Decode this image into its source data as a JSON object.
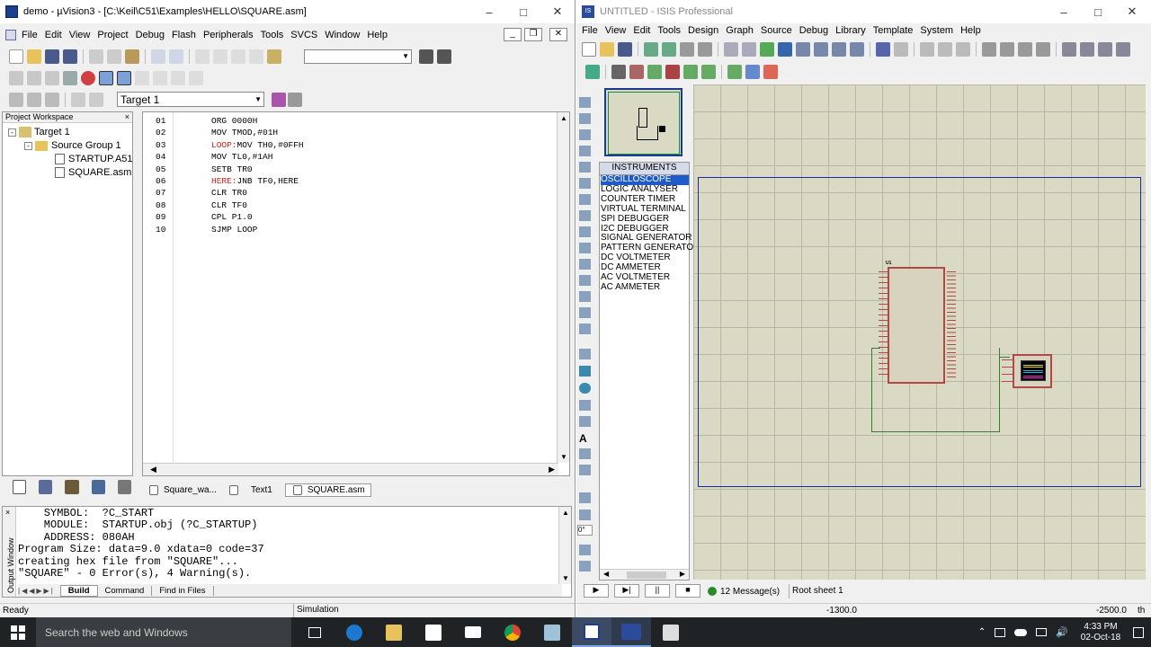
{
  "uv": {
    "title": "demo - µVision3 - [C:\\Keil\\C51\\Examples\\HELLO\\SQUARE.asm]",
    "menus": [
      "File",
      "Edit",
      "View",
      "Project",
      "Debug",
      "Flash",
      "Peripherals",
      "Tools",
      "SVCS",
      "Window",
      "Help"
    ],
    "target": "Target 1",
    "workspace_title": "Project Workspace",
    "tree": [
      "Target 1",
      "Source Group 1",
      "STARTUP.A51",
      "SQUARE.asm"
    ],
    "code": [
      {
        "n": "01",
        "label": "",
        "text": "ORG 0000H"
      },
      {
        "n": "02",
        "label": "",
        "text": "MOV TMOD,#01H"
      },
      {
        "n": "03",
        "label": "LOOP:",
        "text": "MOV TH0,#0FFH"
      },
      {
        "n": "04",
        "label": "",
        "text": "MOV TL0,#1AH"
      },
      {
        "n": "05",
        "label": "",
        "text": "SETB TR0"
      },
      {
        "n": "06",
        "label": "HERE:",
        "text": "JNB TF0,HERE"
      },
      {
        "n": "07",
        "label": "",
        "text": "CLR TR0"
      },
      {
        "n": "08",
        "label": "",
        "text": "CLR TF0"
      },
      {
        "n": "09",
        "label": "",
        "text": "CPL P1.0"
      },
      {
        "n": "10",
        "label": "",
        "text": "SJMP LOOP"
      }
    ],
    "doc_tabs": [
      "Square_wa...",
      "Text1",
      "SQUARE.asm"
    ],
    "output": [
      "    SYMBOL:  ?C_START",
      "    MODULE:  STARTUP.obj (?C_STARTUP)",
      "    ADDRESS: 080AH",
      "Program Size: data=9.0 xdata=0 code=37",
      "creating hex file from \"SQUARE\"...",
      "\"SQUARE\" - 0 Error(s), 4 Warning(s)."
    ],
    "output_label": "Output Window",
    "out_tabs": [
      "Build",
      "Command",
      "Find in Files"
    ],
    "status_left": "Ready",
    "status_mid": "Simulation"
  },
  "isis": {
    "title": "UNTITLED - ISIS Professional",
    "menus": [
      "File",
      "View",
      "Edit",
      "Tools",
      "Design",
      "Graph",
      "Source",
      "Debug",
      "Library",
      "Template",
      "System",
      "Help"
    ],
    "instruments_header": "INSTRUMENTS",
    "instruments": [
      "OSCILLOSCOPE",
      "LOGIC ANALYSER",
      "COUNTER TIMER",
      "VIRTUAL TERMINAL",
      "SPI DEBUGGER",
      "I2C DEBUGGER",
      "SIGNAL GENERATOR",
      "PATTERN GENERATOR",
      "DC VOLTMETER",
      "DC AMMETER",
      "AC VOLTMETER",
      "AC AMMETER"
    ],
    "messages": "12 Message(s)",
    "sheet": "Root sheet 1",
    "coord_x": "-1300.0",
    "coord_y": "-2500.0",
    "coord_unit": "th",
    "angle": "0°",
    "chip_ref": "U1"
  },
  "taskbar": {
    "search": "Search the web and Windows",
    "time": "4:33 PM",
    "date": "02-Oct-18"
  }
}
